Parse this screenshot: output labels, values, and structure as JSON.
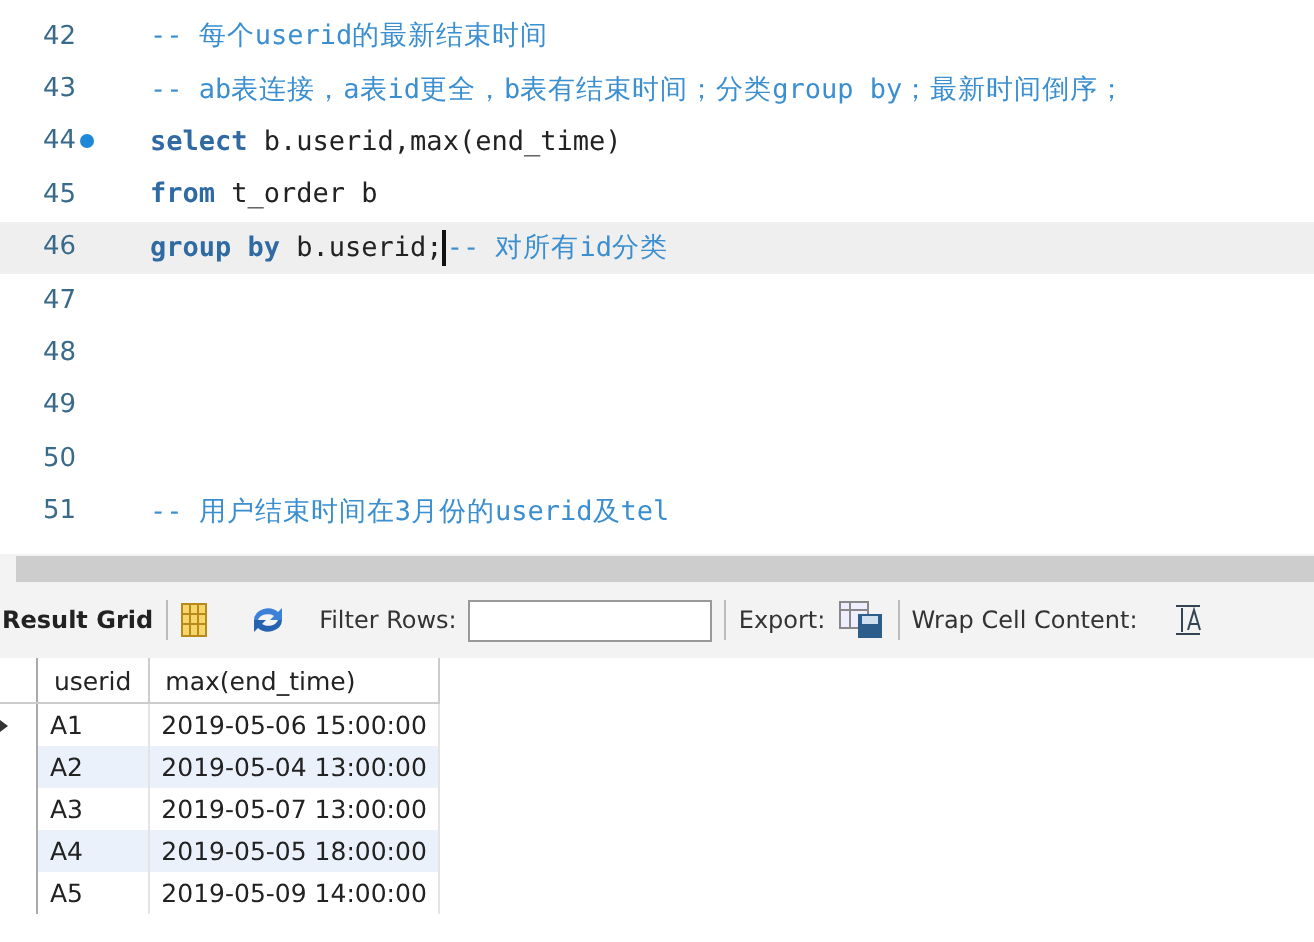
{
  "editor": {
    "lines": [
      {
        "number": "42",
        "current": false,
        "breakpoint": false,
        "segments": [
          {
            "kind": "comment",
            "text": "-- 每个userid的最新结束时间"
          }
        ]
      },
      {
        "number": "43",
        "current": false,
        "breakpoint": false,
        "segments": [
          {
            "kind": "comment",
            "text": "-- ab表连接，a表id更全，b表有结束时间；分类group by；最新时间倒序；"
          }
        ]
      },
      {
        "number": "44",
        "current": false,
        "breakpoint": true,
        "segments": [
          {
            "kind": "keyword",
            "text": "select"
          },
          {
            "kind": "plain",
            "text": " b.userid,max(end_time)"
          }
        ]
      },
      {
        "number": "45",
        "current": false,
        "breakpoint": false,
        "segments": [
          {
            "kind": "keyword",
            "text": "from"
          },
          {
            "kind": "plain",
            "text": " t_order b"
          }
        ]
      },
      {
        "number": "46",
        "current": true,
        "breakpoint": false,
        "segments": [
          {
            "kind": "keyword",
            "text": "group by"
          },
          {
            "kind": "plain",
            "text": " b.userid;"
          },
          {
            "kind": "caret"
          },
          {
            "kind": "comment",
            "text": "-- 对所有id分类"
          }
        ]
      },
      {
        "number": "47",
        "current": false,
        "breakpoint": false
      },
      {
        "number": "48",
        "current": false,
        "breakpoint": false
      },
      {
        "number": "49",
        "current": false,
        "breakpoint": false
      },
      {
        "number": "50",
        "current": false,
        "breakpoint": false
      },
      {
        "number": "51",
        "current": false,
        "breakpoint": false,
        "segments": [
          {
            "kind": "comment",
            "text": "-- 用户结束时间在3月份的userid及tel"
          }
        ]
      }
    ]
  },
  "toolbar": {
    "result_grid": "Result Grid",
    "filter_label": "Filter Rows:",
    "export_label": "Export:",
    "wrap_label": "Wrap Cell Content:"
  },
  "grid": {
    "columns": [
      "userid",
      "max(end_time)"
    ],
    "rows": [
      {
        "selected": true,
        "cells": [
          "A1",
          "2019-05-06 15:00:00"
        ]
      },
      {
        "selected": false,
        "cells": [
          "A2",
          "2019-05-04 13:00:00"
        ]
      },
      {
        "selected": false,
        "cells": [
          "A3",
          "2019-05-07 13:00:00"
        ]
      },
      {
        "selected": false,
        "cells": [
          "A4",
          "2019-05-05 18:00:00"
        ]
      },
      {
        "selected": false,
        "cells": [
          "A5",
          "2019-05-09 14:00:00"
        ]
      }
    ]
  }
}
